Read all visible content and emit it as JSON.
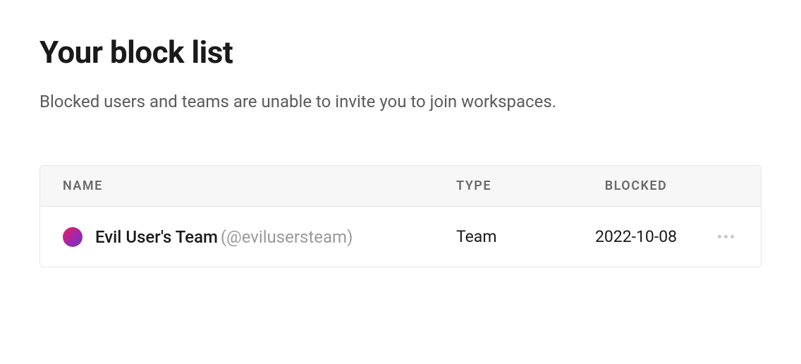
{
  "header": {
    "title": "Your block list",
    "description": "Blocked users and teams are unable to invite you to join workspaces."
  },
  "table": {
    "columns": {
      "name": "NAME",
      "type": "TYPE",
      "blocked": "BLOCKED"
    },
    "rows": [
      {
        "display_name": "Evil User's Team",
        "handle": "(@evilusersteam)",
        "type": "Team",
        "blocked_date": "2022-10-08",
        "avatar_gradient": [
          "#e91e63",
          "#9c27b0",
          "#673ab7"
        ]
      }
    ]
  }
}
